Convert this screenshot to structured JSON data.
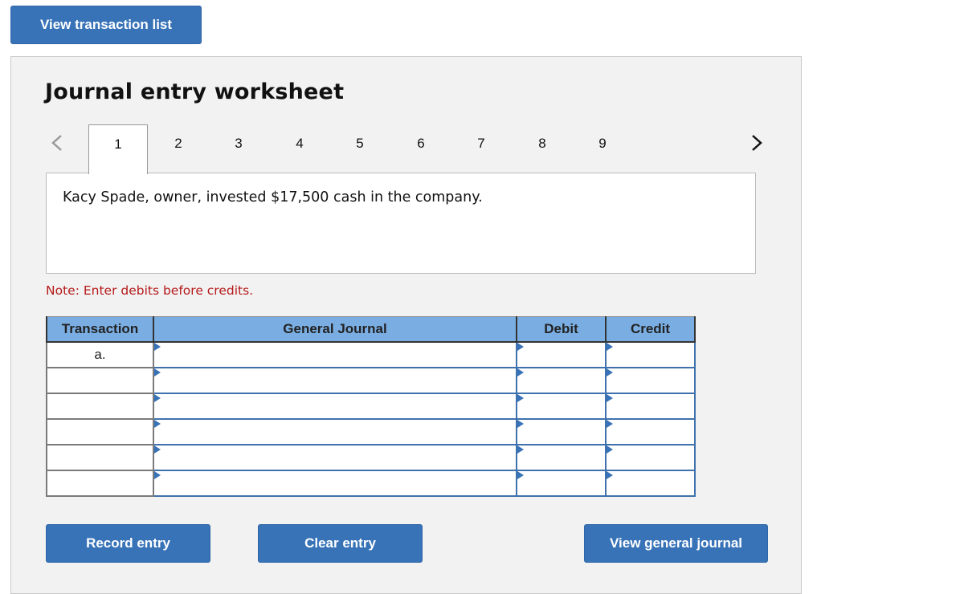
{
  "top": {
    "view_transaction_list_label": "View transaction list"
  },
  "worksheet": {
    "title": "Journal entry worksheet",
    "nav": {
      "prev_icon": "chevron-left-icon",
      "next_icon": "chevron-right-icon"
    },
    "tabs": [
      {
        "label": "1",
        "active": true
      },
      {
        "label": "2",
        "active": false
      },
      {
        "label": "3",
        "active": false
      },
      {
        "label": "4",
        "active": false
      },
      {
        "label": "5",
        "active": false
      },
      {
        "label": "6",
        "active": false
      },
      {
        "label": "7",
        "active": false
      },
      {
        "label": "8",
        "active": false
      },
      {
        "label": "9",
        "active": false
      }
    ],
    "description": "Kacy Spade, owner, invested $17,500 cash in the company.",
    "note": "Note: Enter debits before credits.",
    "table": {
      "headers": [
        "Transaction",
        "General Journal",
        "Debit",
        "Credit"
      ],
      "rows": [
        {
          "transaction": "a.",
          "account": "",
          "debit": "",
          "credit": ""
        },
        {
          "transaction": "",
          "account": "",
          "debit": "",
          "credit": ""
        },
        {
          "transaction": "",
          "account": "",
          "debit": "",
          "credit": ""
        },
        {
          "transaction": "",
          "account": "",
          "debit": "",
          "credit": ""
        },
        {
          "transaction": "",
          "account": "",
          "debit": "",
          "credit": ""
        },
        {
          "transaction": "",
          "account": "",
          "debit": "",
          "credit": ""
        }
      ]
    },
    "buttons": {
      "record_entry": "Record entry",
      "clear_entry": "Clear entry",
      "view_general_journal": "View general journal"
    }
  },
  "colors": {
    "button": "#3873b8",
    "header": "#7aaee3",
    "note": "#b5191a",
    "panel": "#f2f2f2"
  }
}
